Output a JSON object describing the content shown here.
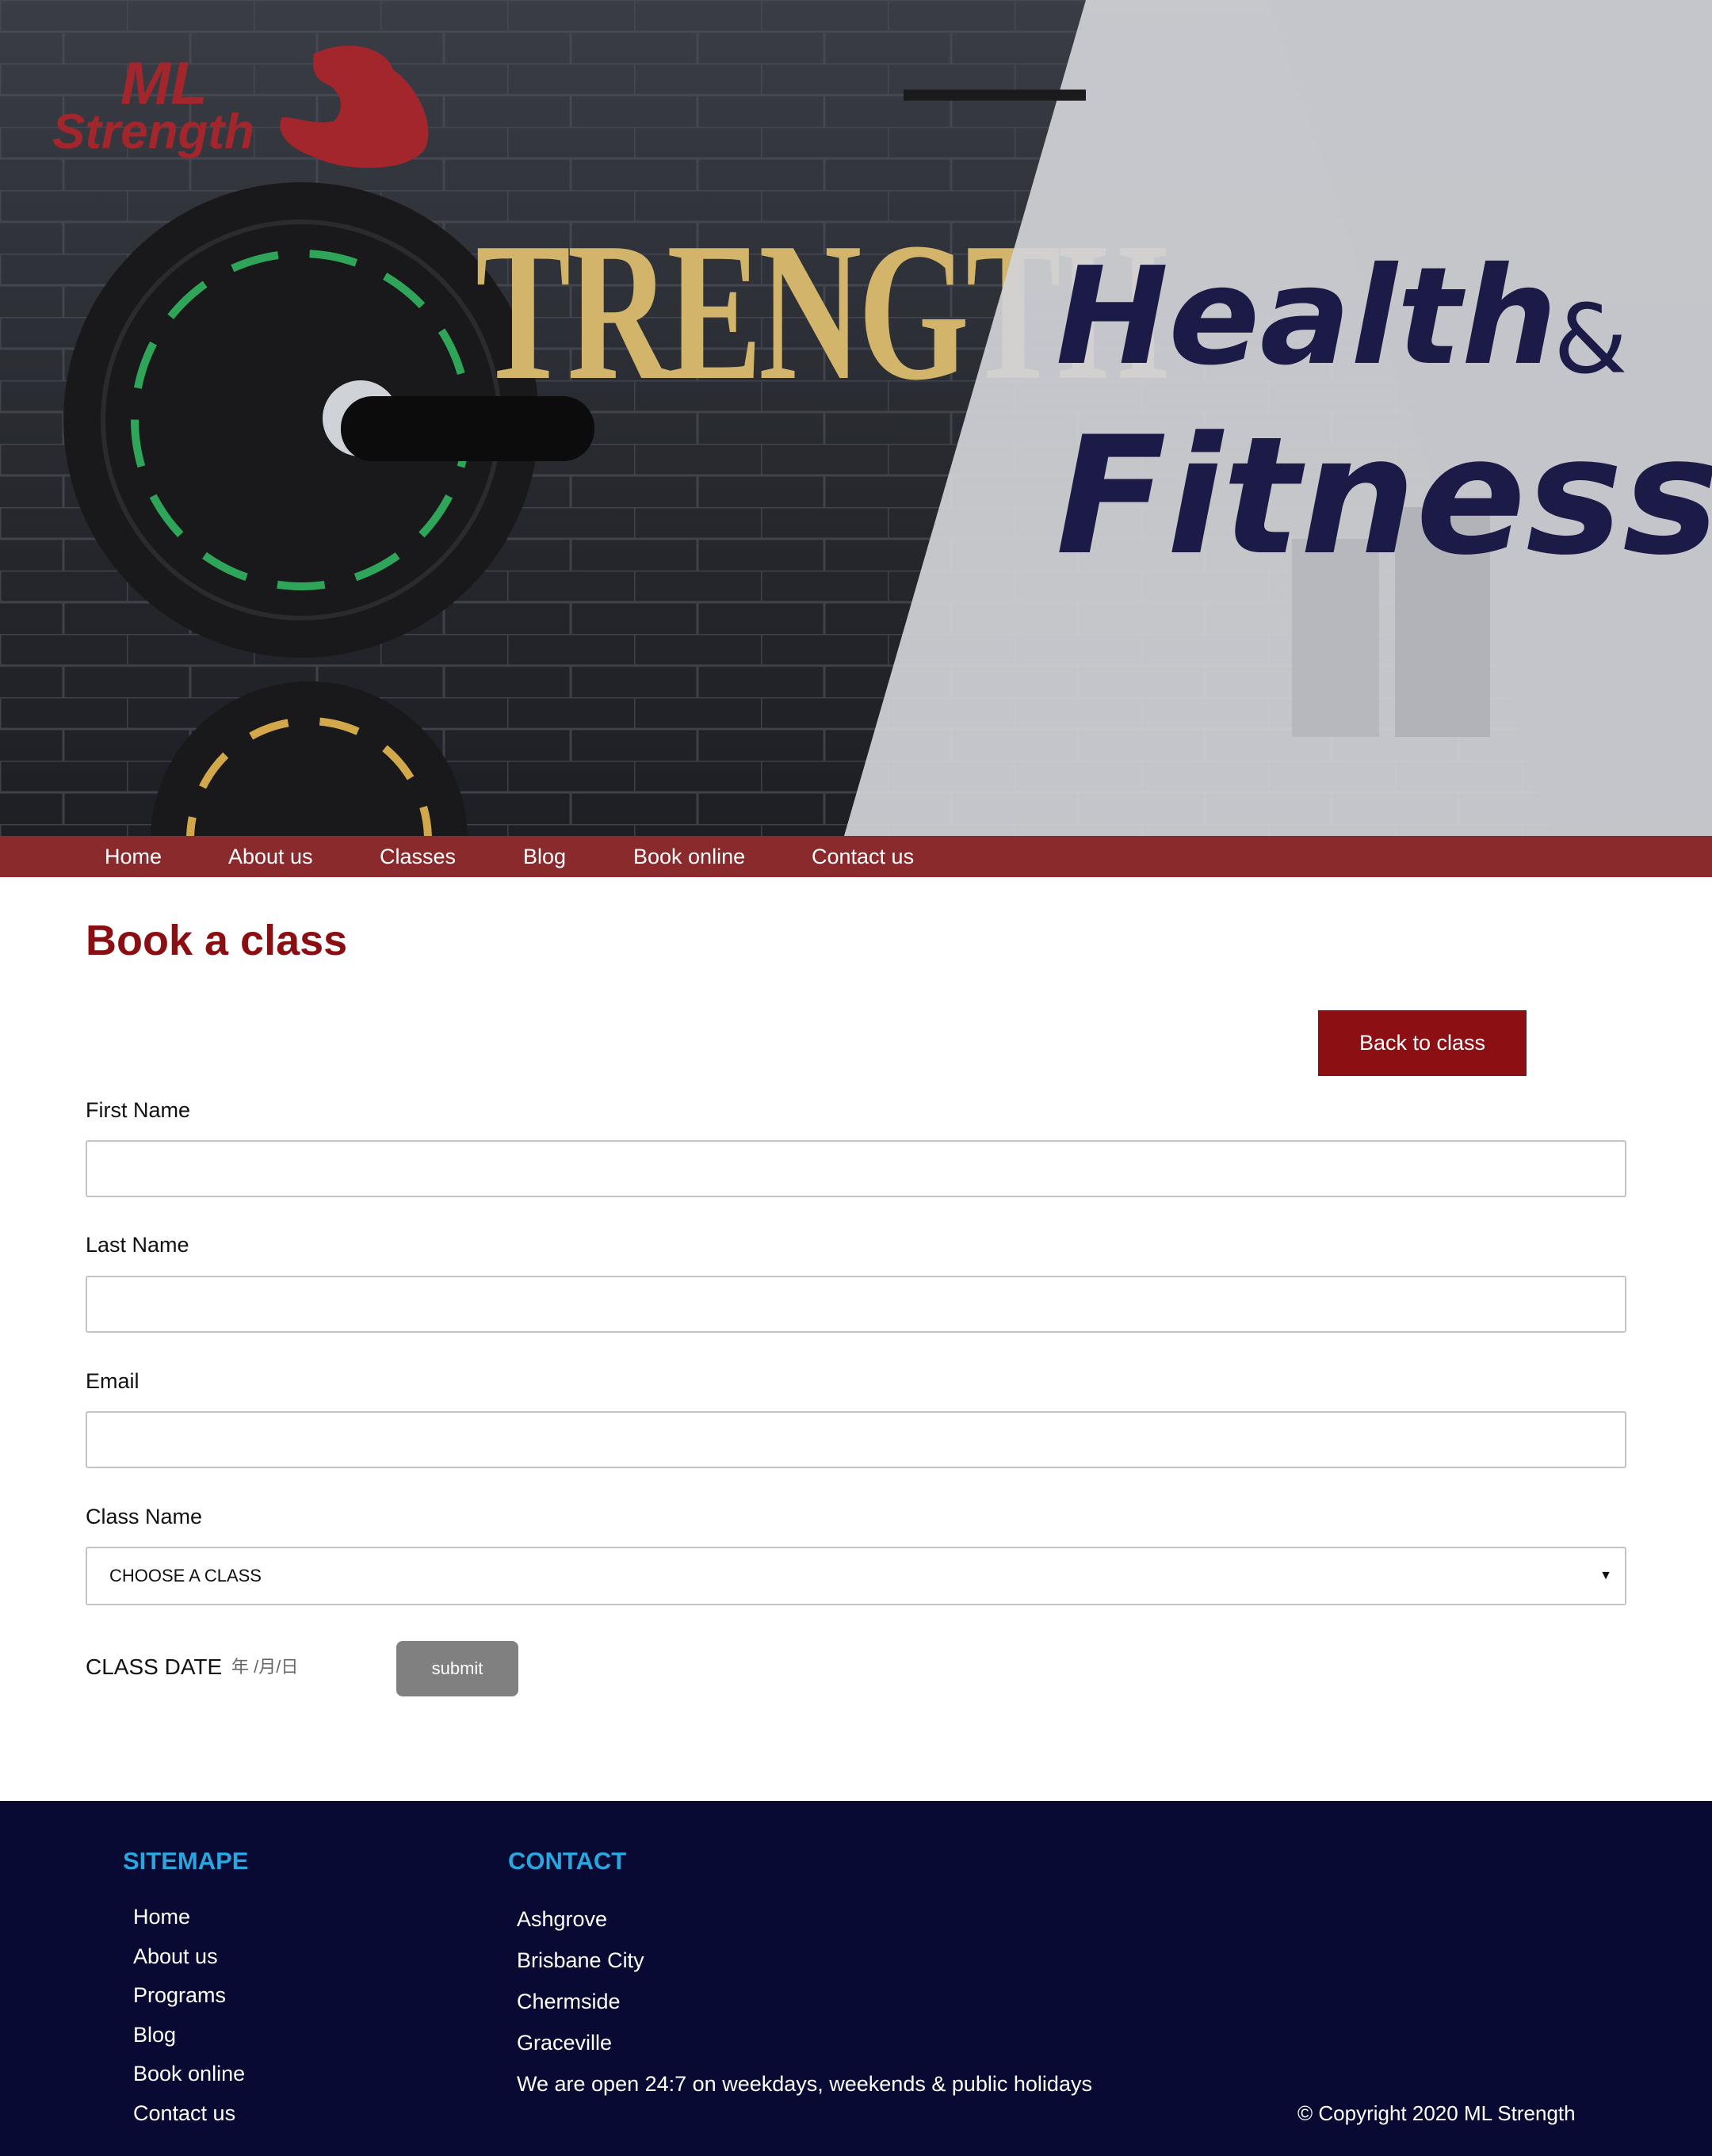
{
  "brand": {
    "logo_line1": "ML",
    "logo_line2": "Strength",
    "colors": {
      "brand_red": "#8a2a2c",
      "title_red": "#8b0e12",
      "hero_navy": "#1c1b48",
      "footer_bg": "#080a33",
      "footer_heading": "#2ba5de"
    }
  },
  "hero": {
    "stencil_text": "TRENGTH",
    "title_line1": "Health",
    "title_amp": "&",
    "title_line2": "Fitness"
  },
  "nav": {
    "items": [
      {
        "label": "Home"
      },
      {
        "label": "About us"
      },
      {
        "label": "Classes"
      },
      {
        "label": "Blog"
      },
      {
        "label": "Book online"
      },
      {
        "label": "Contact us"
      }
    ]
  },
  "main": {
    "title": "Book a class",
    "back_button": "Back to class",
    "fields": {
      "first_name": {
        "label": "First Name",
        "value": ""
      },
      "last_name": {
        "label": "Last Name",
        "value": ""
      },
      "email": {
        "label": "Email",
        "value": ""
      },
      "class_name": {
        "label": "Class Name",
        "selected": "CHOOSE A CLASS",
        "arrow_icon": "dropdown-triangle"
      },
      "class_date": {
        "label": "CLASS DATE",
        "placeholder": "年 /月/日"
      }
    },
    "submit_button": "submit"
  },
  "footer": {
    "sitemap": {
      "heading": "SITEMAPE",
      "links": [
        {
          "label": "Home"
        },
        {
          "label": "About us"
        },
        {
          "label": "Programs"
        },
        {
          "label": "Blog"
        },
        {
          "label": "Book online"
        },
        {
          "label": "Contact us"
        }
      ]
    },
    "contact": {
      "heading": "CONTACT",
      "lines": [
        {
          "label": "Ashgrove"
        },
        {
          "label": "Brisbane City"
        },
        {
          "label": "Chermside"
        },
        {
          "label": "Graceville"
        },
        {
          "label": "We are open 24:7 on weekdays, weekends & public holidays"
        }
      ]
    },
    "copyright": "© Copyright 2020 ML Strength"
  }
}
